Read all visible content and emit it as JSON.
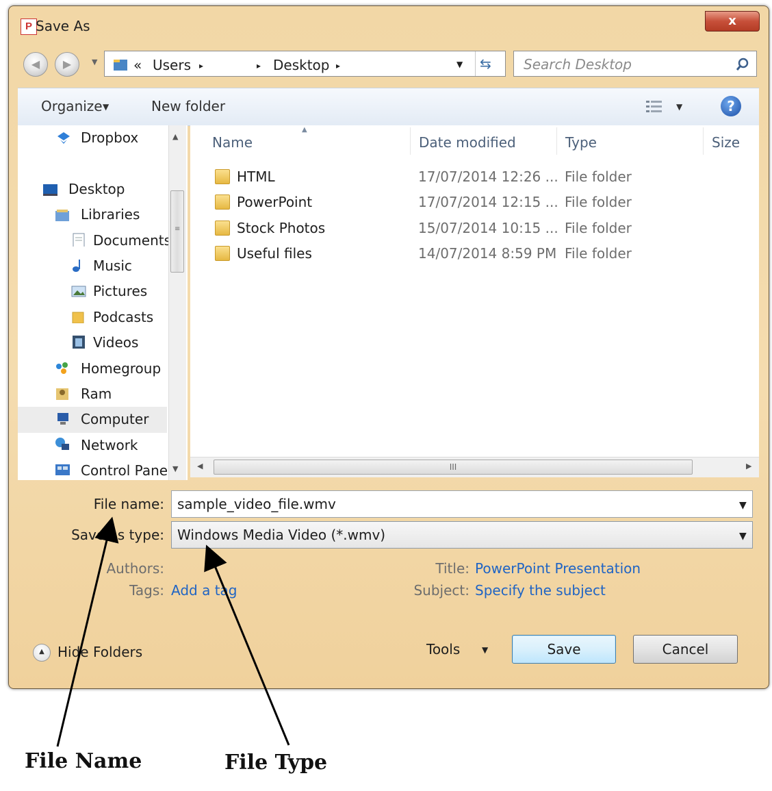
{
  "window": {
    "title": "Save As",
    "app_icon_letter": "P",
    "close_label": "x"
  },
  "address_bar": {
    "breadcrumb_prefix": "«",
    "crumbs": [
      "Users",
      "Desktop"
    ],
    "separator": "▸",
    "search_placeholder": "Search Desktop"
  },
  "toolbar": {
    "organize_label": "Organize",
    "new_folder_label": "New folder"
  },
  "nav_pane": {
    "items": [
      {
        "label": "Dropbox",
        "icon": "dropbox-icon"
      },
      {
        "label": "Desktop",
        "icon": "desktop-icon"
      },
      {
        "label": "Libraries",
        "icon": "libraries-icon"
      },
      {
        "label": "Documents",
        "icon": "documents-icon"
      },
      {
        "label": "Music",
        "icon": "music-icon"
      },
      {
        "label": "Pictures",
        "icon": "pictures-icon"
      },
      {
        "label": "Podcasts",
        "icon": "podcasts-icon"
      },
      {
        "label": "Videos",
        "icon": "videos-icon"
      },
      {
        "label": "Homegroup",
        "icon": "homegroup-icon"
      },
      {
        "label": "Ram",
        "icon": "user-icon"
      },
      {
        "label": "Computer",
        "icon": "computer-icon"
      },
      {
        "label": "Network",
        "icon": "network-icon"
      },
      {
        "label": "Control Panel",
        "icon": "control-panel-icon"
      }
    ]
  },
  "file_list": {
    "columns": [
      "Name",
      "Date modified",
      "Type",
      "Size"
    ],
    "rows": [
      {
        "name": "HTML",
        "date": "17/07/2014 12:26 ...",
        "type": "File folder"
      },
      {
        "name": "PowerPoint",
        "date": "17/07/2014 12:15 ...",
        "type": "File folder"
      },
      {
        "name": "Stock Photos",
        "date": "15/07/2014 10:15 ...",
        "type": "File folder"
      },
      {
        "name": "Useful files",
        "date": "14/07/2014 8:59 PM",
        "type": "File folder"
      }
    ],
    "scroll_grip": "III"
  },
  "form": {
    "file_name_label": "File name:",
    "file_name_value": "sample_video_file.wmv",
    "save_type_label": "Save as type:",
    "save_type_value": "Windows Media Video (*.wmv)",
    "authors_label": "Authors:",
    "tags_label": "Tags:",
    "tags_link": "Add a tag",
    "title_label": "Title:",
    "title_value": "PowerPoint Presentation",
    "subject_label": "Subject:",
    "subject_link": "Specify the subject"
  },
  "footer": {
    "hide_folders_label": "Hide Folders",
    "tools_label": "Tools",
    "save_label": "Save",
    "cancel_label": "Cancel"
  },
  "annotations": {
    "file_name": "File Name",
    "file_type": "File Type"
  }
}
